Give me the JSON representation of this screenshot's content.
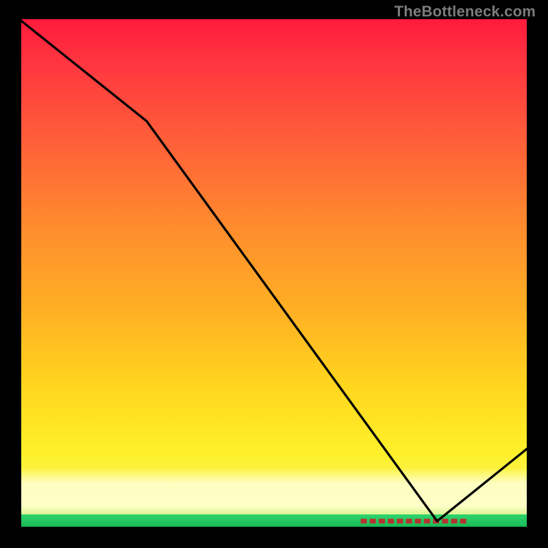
{
  "watermark": "TheBottleneck.com",
  "chart_data": {
    "type": "line",
    "title": "",
    "xlabel": "",
    "ylabel": "",
    "xlim": [
      0,
      100
    ],
    "ylim": [
      0,
      100
    ],
    "grid": false,
    "legend": false,
    "series": [
      {
        "name": "curve",
        "x": [
          0,
          25,
          82,
          100
        ],
        "y": [
          100,
          80,
          1.5,
          16
        ]
      }
    ],
    "marker": {
      "name": "overtake-range",
      "y": 1.5,
      "x_start": 67,
      "x_end": 88,
      "color": "#b6342e"
    },
    "gradient_stops": [
      {
        "pos": 0,
        "color": "#ff1a3c"
      },
      {
        "pos": 40,
        "color": "#ff8a2e"
      },
      {
        "pos": 72,
        "color": "#ffd61e"
      },
      {
        "pos": 94,
        "color": "#f7f760"
      },
      {
        "pos": 97,
        "color": "#bff07a"
      },
      {
        "pos": 100,
        "color": "#0ab14f"
      }
    ]
  }
}
